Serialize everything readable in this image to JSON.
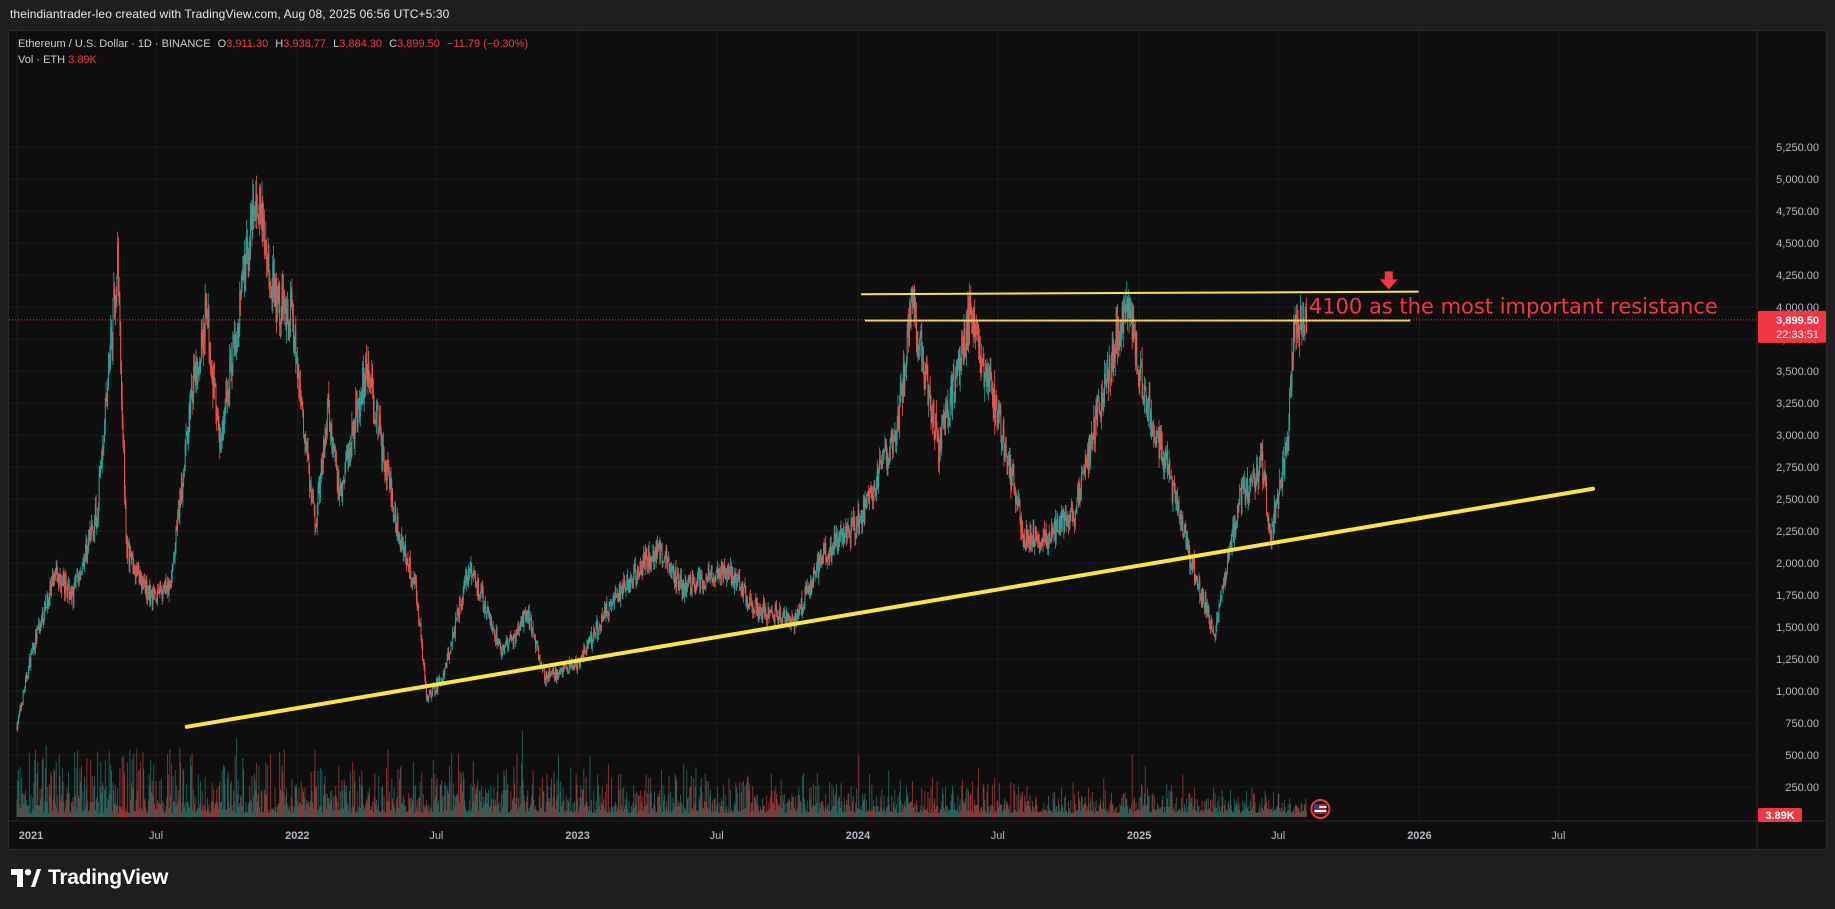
{
  "caption": "theindiantrader-leo created with TradingView.com, Aug 08, 2025 06:56 UTC+5:30",
  "legend": {
    "symbol": "Ethereum / U.S. Dollar · 1D · BINANCE",
    "o_label": "O",
    "o_value": "3,911.30",
    "h_label": "H",
    "h_value": "3,938.77",
    "l_label": "L",
    "l_value": "3,884.30",
    "c_label": "C",
    "c_value": "3,899.50",
    "change": "−11.79 (−0.30%)",
    "vol_label": "Vol · ETH",
    "vol_value": "3.89K"
  },
  "colors": {
    "background": "#0f0f0f",
    "up": "#26a69a",
    "down": "#ef5350",
    "trendline": "#f5e642",
    "resistance": "#f5e642",
    "annotation": "#f23645",
    "price_tag": "#f23645",
    "grid": "#1c1c1c",
    "axis_text": "#b2b5be"
  },
  "footer": {
    "brand": "TradingView",
    "icon": "tradingview-logo-icon"
  },
  "chart_data": {
    "type": "candlestick",
    "symbol": "ETHUSD",
    "interval": "1D",
    "exchange": "BINANCE",
    "y_axis": {
      "min": 100,
      "max": 5350,
      "scale": "linear",
      "ticks": [
        250,
        500,
        750,
        1000,
        1250,
        1500,
        1750,
        2000,
        2250,
        2500,
        2750,
        3000,
        3250,
        3500,
        3750,
        4000,
        4250,
        4500,
        4750,
        5000,
        5250
      ],
      "tick_labels": [
        "250.00",
        "500.00",
        "750.00",
        "1,000.00",
        "1,250.00",
        "1,500.00",
        "1,750.00",
        "2,000.00",
        "2,250.00",
        "2,500.00",
        "2,750.00",
        "3,000.00",
        "3,250.00",
        "3,500.00",
        "3,750.00",
        "4,000.00",
        "4,250.00",
        "4,500.00",
        "4,750.00",
        "5,000.00",
        "5,250.00"
      ]
    },
    "x_axis": {
      "min": "2021-01-01",
      "max": "2026-12-31",
      "ticks": [
        {
          "date": "2021-01-01",
          "label": "2021"
        },
        {
          "date": "2021-07-01",
          "label": "Jul"
        },
        {
          "date": "2022-01-01",
          "label": "2022"
        },
        {
          "date": "2022-07-01",
          "label": "Jul"
        },
        {
          "date": "2023-01-01",
          "label": "2023"
        },
        {
          "date": "2023-07-01",
          "label": "Jul"
        },
        {
          "date": "2024-01-01",
          "label": "2024"
        },
        {
          "date": "2024-07-01",
          "label": "Jul"
        },
        {
          "date": "2025-01-01",
          "label": "2025"
        },
        {
          "date": "2025-07-01",
          "label": "Jul"
        },
        {
          "date": "2026-01-01",
          "label": "2026"
        },
        {
          "date": "2026-07-01",
          "label": "Jul"
        }
      ]
    },
    "price_path": [
      [
        "2021-01-01",
        730
      ],
      [
        "2021-01-20",
        1300
      ],
      [
        "2021-02-20",
        1900
      ],
      [
        "2021-03-15",
        1750
      ],
      [
        "2021-04-15",
        2400
      ],
      [
        "2021-05-12",
        4350
      ],
      [
        "2021-05-24",
        2100
      ],
      [
        "2021-06-22",
        1750
      ],
      [
        "2021-07-20",
        1800
      ],
      [
        "2021-08-15",
        3250
      ],
      [
        "2021-09-05",
        3950
      ],
      [
        "2021-09-22",
        2900
      ],
      [
        "2021-10-20",
        4150
      ],
      [
        "2021-11-10",
        4850
      ],
      [
        "2021-12-04",
        4050
      ],
      [
        "2021-12-25",
        3950
      ],
      [
        "2022-01-24",
        2250
      ],
      [
        "2022-02-10",
        3200
      ],
      [
        "2022-02-25",
        2550
      ],
      [
        "2022-04-02",
        3550
      ],
      [
        "2022-05-10",
        2300
      ],
      [
        "2022-06-05",
        1800
      ],
      [
        "2022-06-18",
        950
      ],
      [
        "2022-07-10",
        1100
      ],
      [
        "2022-08-13",
        2000
      ],
      [
        "2022-09-25",
        1300
      ],
      [
        "2022-10-28",
        1600
      ],
      [
        "2022-11-20",
        1100
      ],
      [
        "2022-12-31",
        1200
      ],
      [
        "2023-02-15",
        1700
      ],
      [
        "2023-04-15",
        2120
      ],
      [
        "2023-05-20",
        1800
      ],
      [
        "2023-07-15",
        1950
      ],
      [
        "2023-08-20",
        1650
      ],
      [
        "2023-10-10",
        1550
      ],
      [
        "2023-11-15",
        2050
      ],
      [
        "2023-12-31",
        2300
      ],
      [
        "2024-02-20",
        3000
      ],
      [
        "2024-03-12",
        4050
      ],
      [
        "2024-04-15",
        2900
      ],
      [
        "2024-05-25",
        3900
      ],
      [
        "2024-06-25",
        3300
      ],
      [
        "2024-08-05",
        2200
      ],
      [
        "2024-09-06",
        2200
      ],
      [
        "2024-10-10",
        2400
      ],
      [
        "2024-11-10",
        3200
      ],
      [
        "2024-12-16",
        4050
      ],
      [
        "2025-01-10",
        3250
      ],
      [
        "2025-02-04",
        2800
      ],
      [
        "2025-03-10",
        2000
      ],
      [
        "2025-04-09",
        1450
      ],
      [
        "2025-05-12",
        2500
      ],
      [
        "2025-06-10",
        2750
      ],
      [
        "2025-06-22",
        2200
      ],
      [
        "2025-07-14",
        3000
      ],
      [
        "2025-07-21",
        3800
      ],
      [
        "2025-08-07",
        3899.5
      ]
    ],
    "last_price": {
      "value": 3899.5,
      "label": "3,899.50",
      "countdown": "22:33:51"
    },
    "volume": {
      "last_label": "3.89K"
    },
    "annotations": [
      {
        "type": "trendline",
        "from": [
          "2021-08-10",
          720
        ],
        "to": [
          "2026-08-15",
          2580
        ]
      },
      {
        "type": "horizontal",
        "from": [
          "2024-01-05",
          4100
        ],
        "to": [
          "2025-12-31",
          4120
        ]
      },
      {
        "type": "horizontal",
        "from": [
          "2024-01-10",
          3895
        ],
        "to": [
          "2025-12-20",
          3895
        ]
      },
      {
        "type": "arrow-down",
        "at": [
          "2025-11-22",
          4200
        ]
      },
      {
        "type": "text",
        "text": "4100 as the most important resistance",
        "at": [
          "2025-08-10",
          3950
        ]
      }
    ]
  }
}
